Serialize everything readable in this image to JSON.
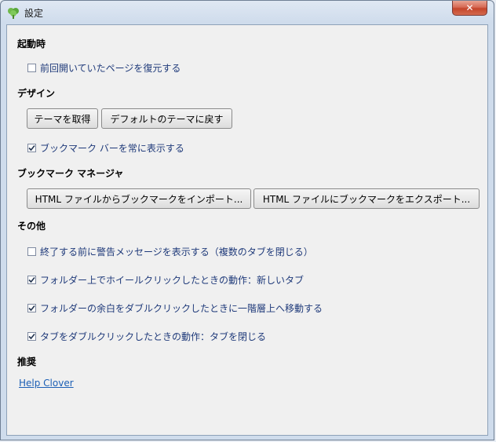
{
  "window": {
    "title": "設定"
  },
  "sections": {
    "startup": {
      "title": "起動時",
      "restore_pages": {
        "label": "前回開いていたページを復元する",
        "checked": false
      }
    },
    "design": {
      "title": "デザイン",
      "get_theme_label": "テーマを取得",
      "reset_theme_label": "デフォルトのテーマに戻す",
      "show_bookmark_bar": {
        "label": "ブックマーク バーを常に表示する",
        "checked": true
      }
    },
    "bookmark_manager": {
      "title": "ブックマーク マネージャ",
      "import_label": "HTML ファイルからブックマークをインポート...",
      "export_label": "HTML ファイルにブックマークをエクスポート..."
    },
    "other": {
      "title": "その他",
      "items": [
        {
          "label": "終了する前に警告メッセージを表示する（複数のタブを閉じる）",
          "checked": false
        },
        {
          "label": "フォルダー上でホイールクリックしたときの動作：新しいタブ",
          "checked": true
        },
        {
          "label": "フォルダーの余白をダブルクリックしたときに一階層上へ移動する",
          "checked": true
        },
        {
          "label": "タブをダブルクリックしたときの動作：タブを閉じる",
          "checked": true
        }
      ]
    },
    "recommend": {
      "title": "推奨",
      "link_label": "Help Clover"
    }
  },
  "colors": {
    "accent": "#1c5fb5",
    "close_button": "#c4452a"
  }
}
